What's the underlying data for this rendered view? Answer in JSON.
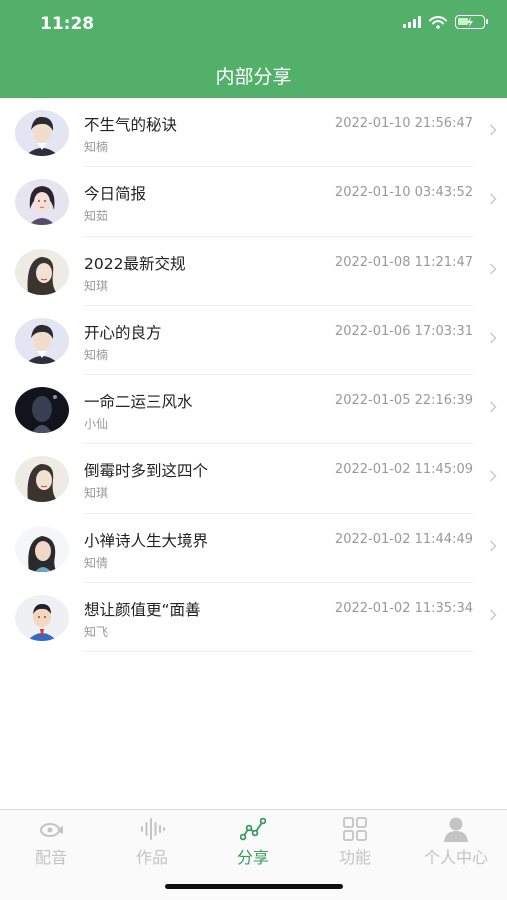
{
  "status_bar": {
    "time": "11:28"
  },
  "header": {
    "title": "内部分享"
  },
  "shares": [
    {
      "title": "不生气的秘诀",
      "author": "知楠",
      "time": "2022-01-10 21:56:47",
      "avatar": "man-illustration"
    },
    {
      "title": "今日简报",
      "author": "知茹",
      "time": "2022-01-10 03:43:52",
      "avatar": "woman-illustration"
    },
    {
      "title": "2022最新交规",
      "author": "知琪",
      "time": "2022-01-08 11:21:47",
      "avatar": "woman-sketch"
    },
    {
      "title": "开心的良方",
      "author": "知楠",
      "time": "2022-01-06 17:03:31",
      "avatar": "man-illustration"
    },
    {
      "title": "一命二运三风水",
      "author": "小仙",
      "time": "2022-01-05 22:16:39",
      "avatar": "dark-figure"
    },
    {
      "title": "倒霉时多到这四个",
      "author": "知琪",
      "time": "2022-01-02 11:45:09",
      "avatar": "woman-sketch"
    },
    {
      "title": "小禅诗人生大境界",
      "author": "知倩",
      "time": "2022-01-02 11:44:49",
      "avatar": "woman-photo"
    },
    {
      "title": "想让颜值更“面善",
      "author": "知飞",
      "time": "2022-01-02 11:35:34",
      "avatar": "man-cartoon"
    }
  ],
  "tabbar": {
    "tabs": [
      {
        "label": "配音",
        "icon": "microphone-icon",
        "active": false
      },
      {
        "label": "作品",
        "icon": "waveform-icon",
        "active": false
      },
      {
        "label": "分享",
        "icon": "share-graph-icon",
        "active": true
      },
      {
        "label": "功能",
        "icon": "grid-icon",
        "active": false
      },
      {
        "label": "个人中心",
        "icon": "person-icon",
        "active": false
      }
    ]
  },
  "colors": {
    "header_bg": "#52b06a",
    "active_tab": "#3a9a5a",
    "inactive_tab": "#c4c4c4"
  }
}
